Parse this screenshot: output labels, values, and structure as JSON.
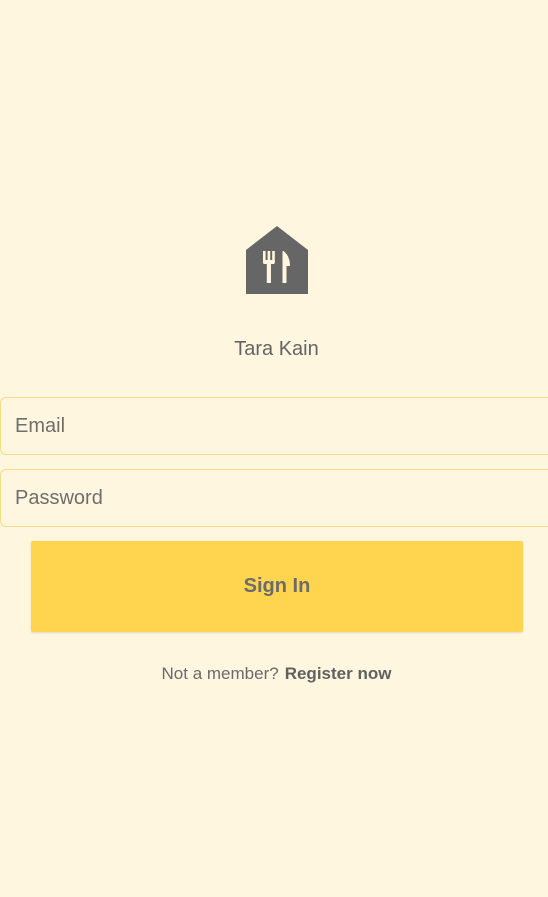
{
  "app": {
    "name": "Tara Kain",
    "logo_icon": "restaurant-house-icon",
    "icon_color": "#666666",
    "background_color": "#FFF6E0",
    "accent_color": "#FFD54F"
  },
  "form": {
    "email_placeholder": "Email",
    "email_value": "",
    "password_placeholder": "Password",
    "password_value": "",
    "sign_in_label": "Sign In"
  },
  "register": {
    "prompt": "Not a member?",
    "link_label": "Register now"
  }
}
